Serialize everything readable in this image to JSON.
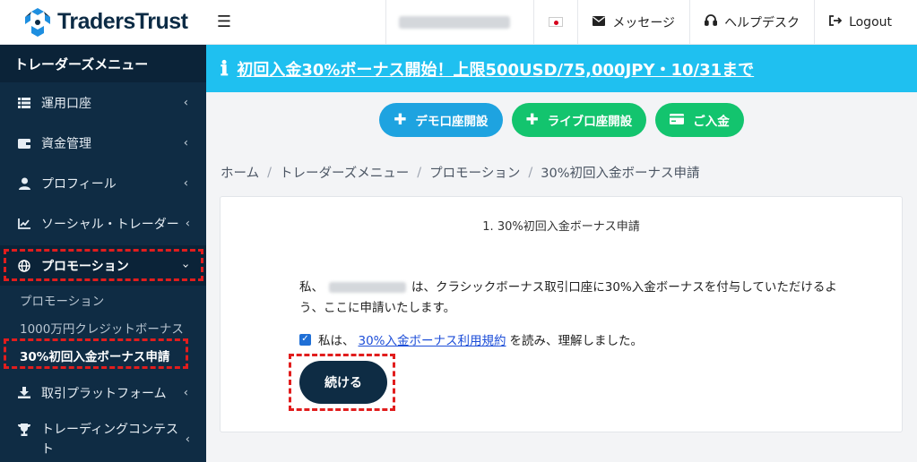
{
  "brand": {
    "name": "TradersTrust"
  },
  "sidebar": {
    "title": "トレーダーズメニュー",
    "items": [
      {
        "label": "運用口座",
        "icon": "list-icon"
      },
      {
        "label": "資金管理",
        "icon": "wallet-icon"
      },
      {
        "label": "プロフィール",
        "icon": "user-icon"
      },
      {
        "label": "ソーシャル・トレーダー",
        "icon": "chart-line-icon"
      },
      {
        "label": "プロモーション",
        "icon": "globe-icon"
      },
      {
        "label": "取引プラットフォーム",
        "icon": "download-icon"
      },
      {
        "label": "トレーディングコンテスト",
        "icon": "trophy-icon"
      }
    ],
    "sub_items": [
      {
        "label": "プロモーション"
      },
      {
        "label": "1000万円クレジットボーナス"
      },
      {
        "label": "30%初回入金ボーナス申請"
      }
    ]
  },
  "topbar": {
    "messages_label": "メッセージ",
    "helpdesk_label": "ヘルプデスク",
    "logout_label": "Logout"
  },
  "banner": {
    "text": "初回入金30%ボーナス開始！上限500USD/75,000JPY・10/31まで"
  },
  "actions": {
    "demo_label": "デモ口座開設",
    "live_label": "ライブ口座開設",
    "deposit_label": "ご入金"
  },
  "breadcrumb": [
    "ホーム",
    "トレーダーズメニュー",
    "プロモーション",
    "30%初回入金ボーナス申請"
  ],
  "card": {
    "title": "1. 30%初回入金ボーナス申請",
    "body_prefix": "私、",
    "body_suffix": "は、クラシックボーナス取引口座に30%入金ボーナスを付与していただけるよう、ここに申請いたします。",
    "agree_prefix": "私は、",
    "agree_link": "30%入金ボーナス利用規約",
    "agree_suffix": "を読み、理解しました。",
    "continue_label": "続ける"
  },
  "colors": {
    "sidebar_bg": "#0f2c44",
    "banner_bg": "#1fc0f0",
    "demo_button": "#1ea3e0",
    "live_button": "#13c46e",
    "continue_button": "#0e2c44",
    "highlight_dashed": "#e11d1d"
  }
}
